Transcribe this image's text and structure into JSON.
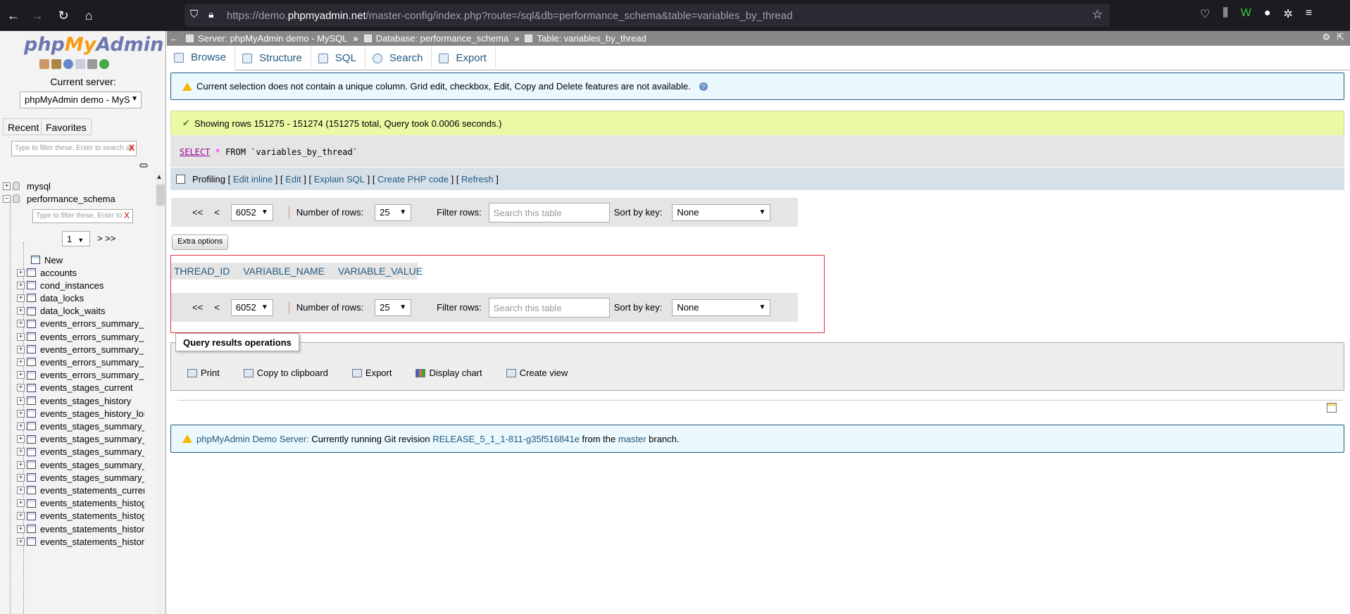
{
  "browser": {
    "url_prefix": "https://demo.",
    "url_domain": "phpmyadmin.net",
    "url_suffix": "/master-config/index.php?route=/sql&db=performance_schema&table=variables_by_thread"
  },
  "nav": {
    "logo_php": "php",
    "logo_my": "My",
    "logo_admin": "Admin",
    "current_server_label": "Current server:",
    "server_selected": "phpMyAdmin demo - MyS",
    "tabs": [
      "Recent",
      "Favorites"
    ],
    "filter_placeholder": "Type to filter these, Enter to search a",
    "filter_clear": "X",
    "databases": [
      "mysql",
      "performance_schema"
    ],
    "tree_filter_placeholder": "Type to filter these, Enter to",
    "tree_filter_clear": "X",
    "page_selected": "1",
    "page_next": "> >>",
    "new_label": "New",
    "tables": [
      "accounts",
      "cond_instances",
      "data_locks",
      "data_lock_waits",
      "events_errors_summary_by",
      "events_errors_summary_by",
      "events_errors_summary_by",
      "events_errors_summary_by",
      "events_errors_summary_gl",
      "events_stages_current",
      "events_stages_history",
      "events_stages_history_lon",
      "events_stages_summary_b",
      "events_stages_summary_b",
      "events_stages_summary_b",
      "events_stages_summary_b",
      "events_stages_summary_g",
      "events_statements_current",
      "events_statements_histogr",
      "events_statements_histogr",
      "events_statements_history",
      "events_statements_history"
    ]
  },
  "breadcrumb": {
    "server": "Server: phpMyAdmin demo - MySQL",
    "database": "Database: performance_schema",
    "table": "Table: variables_by_thread",
    "separator": "»"
  },
  "tabs": [
    "Browse",
    "Structure",
    "SQL",
    "Search",
    "Export"
  ],
  "notice_text": "Current selection does not contain a unique column. Grid edit, checkbox, Edit, Copy and Delete features are not available.",
  "success_text": "Showing rows 151275 - 151274 (151275 total, Query took 0.0006 seconds.)",
  "sql": {
    "select": "SELECT",
    "star": "*",
    "from": "FROM",
    "table": "`variables_by_thread`"
  },
  "profiling": {
    "label": "Profiling",
    "links": [
      "Edit inline",
      "Edit",
      "Explain SQL",
      "Create PHP code",
      "Refresh"
    ]
  },
  "navigation": {
    "first": "<<",
    "prev": "<",
    "page": "6052",
    "rows_label": "Number of rows:",
    "rows_value": "25",
    "filter_label": "Filter rows:",
    "filter_placeholder": "Search this table",
    "sort_label": "Sort by key:",
    "sort_value": "None"
  },
  "extra_options": "Extra options",
  "columns": [
    "THREAD_ID",
    "VARIABLE_NAME",
    "VARIABLE_VALUE"
  ],
  "qro": {
    "legend": "Query results operations",
    "actions": [
      "Print",
      "Copy to clipboard",
      "Export",
      "Display chart",
      "Create view"
    ]
  },
  "footer": {
    "link1": "phpMyAdmin Demo Server:",
    "text1": " Currently running Git revision ",
    "link2": "RELEASE_5_1_1-811-g35f516841e",
    "text2": " from the ",
    "link3": "master",
    "text3": " branch."
  }
}
